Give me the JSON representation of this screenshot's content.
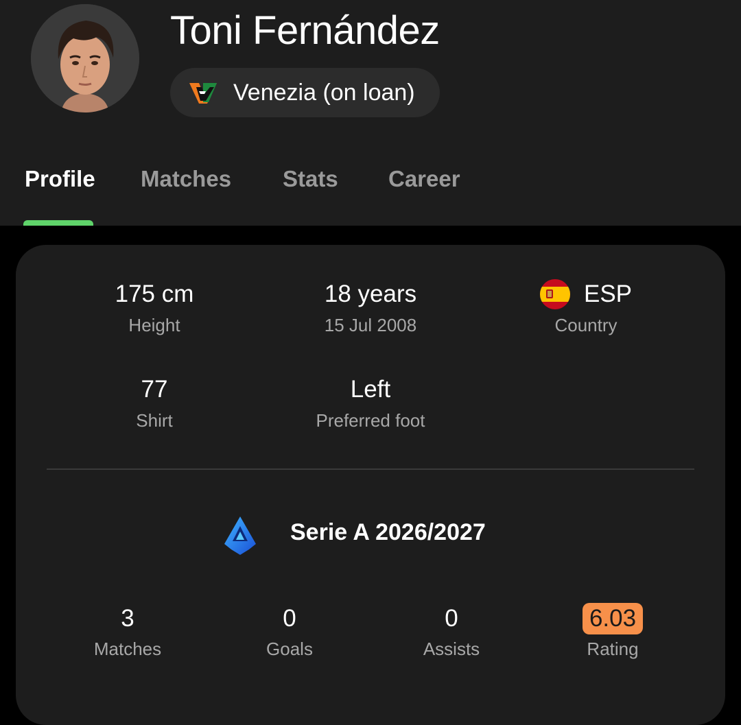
{
  "player": {
    "name": "Toni Fernández",
    "team_label": "Venezia (on loan)"
  },
  "tabs": [
    {
      "label": "Profile",
      "active": true
    },
    {
      "label": "Matches",
      "active": false
    },
    {
      "label": "Stats",
      "active": false
    },
    {
      "label": "Career",
      "active": false
    }
  ],
  "info": {
    "height": {
      "value": "175 cm",
      "label": "Height"
    },
    "age": {
      "value": "18 years",
      "label": "15 Jul 2008"
    },
    "country": {
      "value": "ESP",
      "label": "Country",
      "flag_icon": "spain-flag-icon"
    },
    "shirt": {
      "value": "77",
      "label": "Shirt"
    },
    "foot": {
      "value": "Left",
      "label": "Preferred foot"
    }
  },
  "league": {
    "title": "Serie A 2026/2027",
    "icon": "serie-a-logo"
  },
  "season_stats": [
    {
      "value": "3",
      "label": "Matches"
    },
    {
      "value": "0",
      "label": "Goals"
    },
    {
      "value": "0",
      "label": "Assists"
    },
    {
      "value": "6.03",
      "label": "Rating",
      "badge_color": "#f7904a"
    }
  ],
  "colors": {
    "accent": "#5fd36a",
    "rating": "#f7904a",
    "surface": "#1d1d1d",
    "background": "#000000"
  }
}
